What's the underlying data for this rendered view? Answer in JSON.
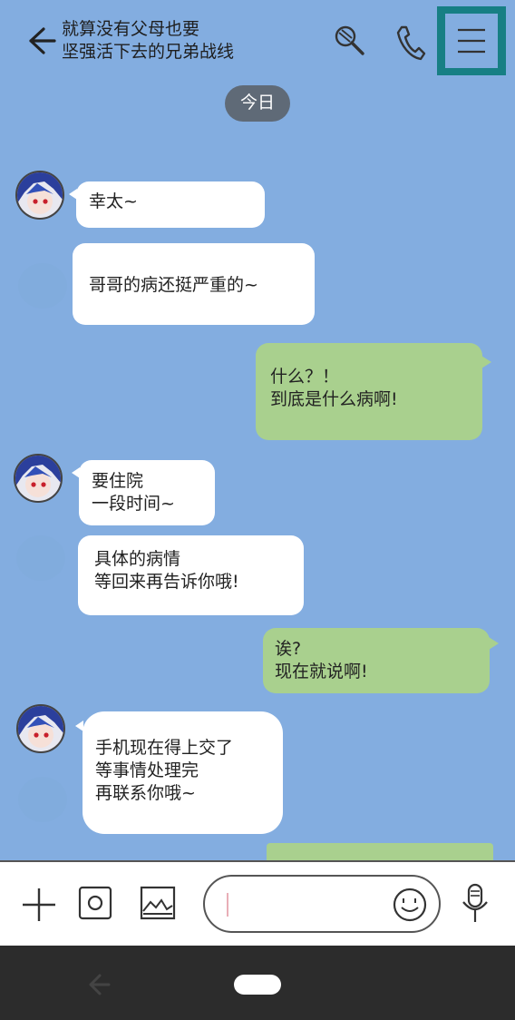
{
  "header": {
    "title_line1": "就算没有父母也要",
    "title_line2": "坚强活下去的兄弟战线"
  },
  "date_label": "今日",
  "messages": [
    {
      "side": "left",
      "lines": [
        "幸太~"
      ]
    },
    {
      "side": "left",
      "lines": [
        "哥哥的病还挺严重的~"
      ]
    },
    {
      "side": "right",
      "lines": [
        "什么？！",
        "到底是什么病啊!"
      ]
    },
    {
      "side": "left",
      "lines": [
        "要住院",
        "一段时间~"
      ]
    },
    {
      "side": "left",
      "lines": [
        "具体的病情",
        "等回来再告诉你哦!"
      ]
    },
    {
      "side": "right",
      "lines": [
        "诶?",
        "现在就说啊!"
      ]
    },
    {
      "side": "left",
      "lines": [
        "手机现在得上交了",
        "等事情处理完",
        "再联系你哦~"
      ]
    }
  ],
  "input": {
    "value": ""
  },
  "colors": {
    "background": "#83ade0",
    "bubble_in": "#ffffff",
    "bubble_out": "#a9d08e",
    "menu_highlight": "#177f84",
    "date_pill": "#5f6a77"
  },
  "icons": [
    "back-arrow-icon",
    "search-icon",
    "phone-icon",
    "menu-icon",
    "plus-icon",
    "camera-icon",
    "image-icon",
    "emoji-icon",
    "microphone-icon",
    "nav-back-icon",
    "nav-home-icon"
  ]
}
